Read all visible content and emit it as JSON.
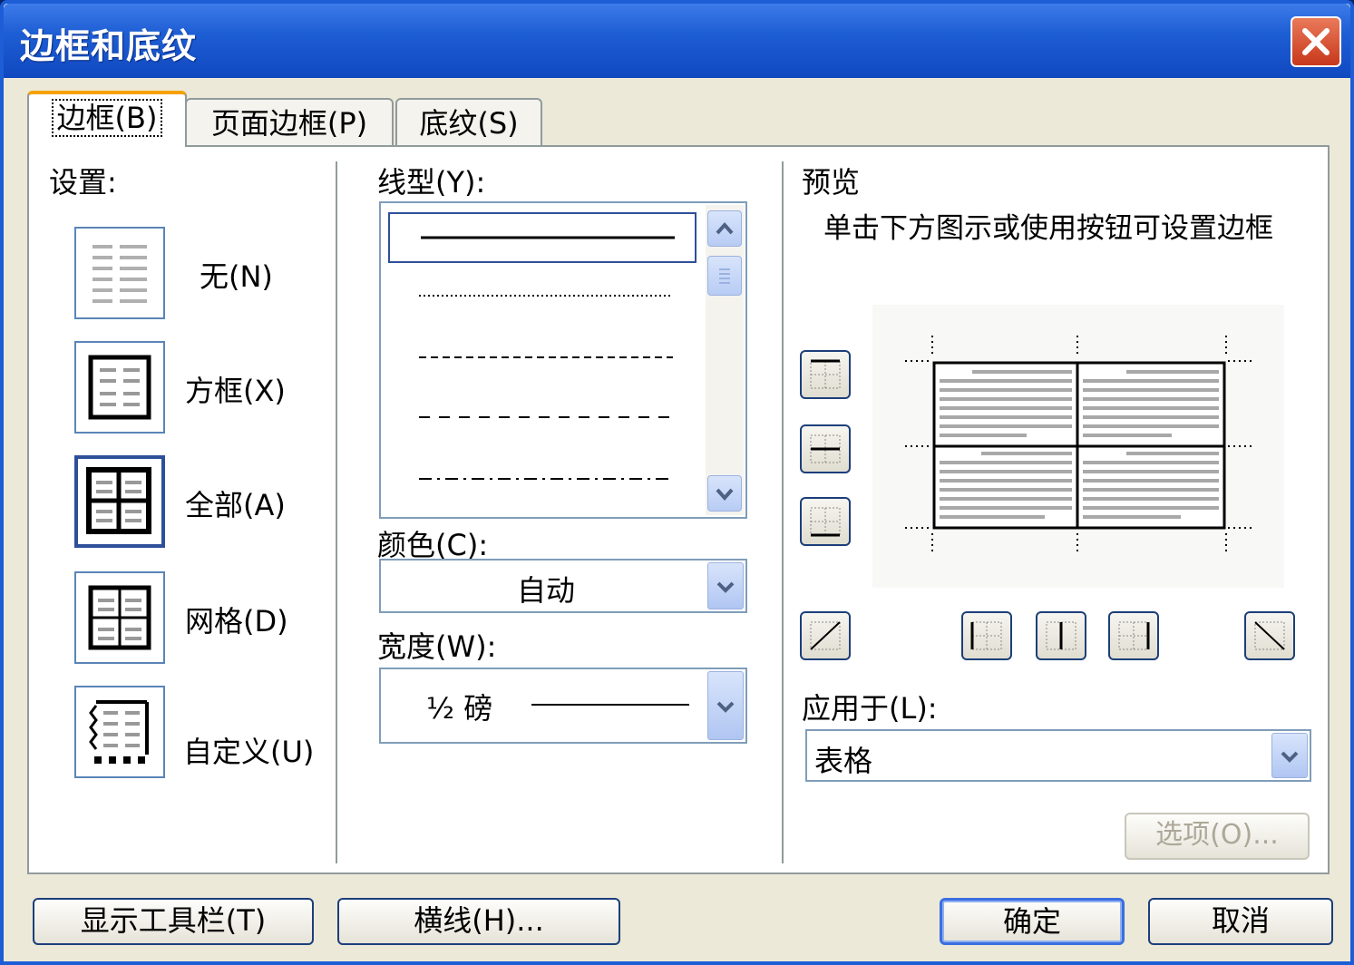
{
  "window": {
    "title": "边框和底纹"
  },
  "tabs": [
    {
      "label": "边框(B)",
      "active": true
    },
    {
      "label": "页面边框(P)",
      "active": false
    },
    {
      "label": "底纹(S)",
      "active": false
    }
  ],
  "settings": {
    "label": "设置:",
    "options": [
      {
        "label": "无(N)",
        "icon": "none-border-icon"
      },
      {
        "label": "方框(X)",
        "icon": "box-border-icon"
      },
      {
        "label": "全部(A)",
        "icon": "all-border-icon",
        "selected": true
      },
      {
        "label": "网格(D)",
        "icon": "grid-border-icon"
      },
      {
        "label": "自定义(U)",
        "icon": "custom-border-icon"
      }
    ]
  },
  "line_style": {
    "label": "线型(Y):",
    "styles": [
      "solid",
      "dotted",
      "dashed-small",
      "dashed",
      "dash-dot"
    ],
    "selected": "solid"
  },
  "color": {
    "label": "颜色(C):",
    "value": "自动"
  },
  "width": {
    "label": "宽度(W):",
    "value": "½ 磅"
  },
  "preview": {
    "label": "预览",
    "hint": "单击下方图示或使用按钮可设置边框"
  },
  "apply_to": {
    "label": "应用于(L):",
    "value": "表格"
  },
  "options_button": "选项(O)...",
  "footer": {
    "show_toolbar": "显示工具栏(T)",
    "horizontal_line": "横线(H)...",
    "ok": "确定",
    "cancel": "取消"
  },
  "colors": {
    "titlebar": "#1e5ed4",
    "active_tab": "#f6a100",
    "panel": "#ffffff",
    "window": "#ece9d8"
  }
}
